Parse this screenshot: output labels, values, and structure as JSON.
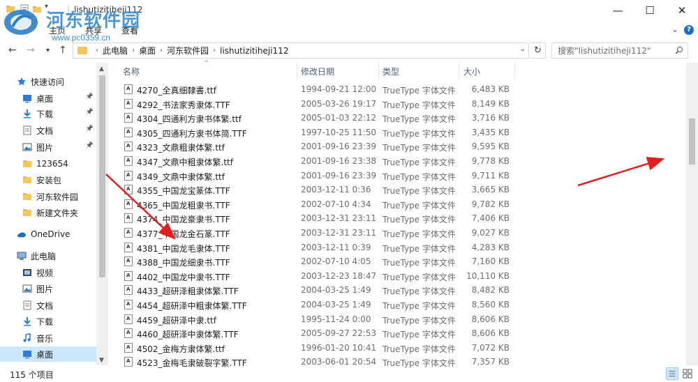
{
  "window": {
    "title": "lishutizitiheji112",
    "minimize_glyph": "—",
    "maximize_glyph": "☐",
    "close_glyph": "✕"
  },
  "watermark": {
    "title": "河东软件园",
    "url": "www.pc0359.cn"
  },
  "ribbon": {
    "tabs": [
      "文件",
      "主页",
      "共享",
      "查看"
    ],
    "expand_glyph": "⌄",
    "help_glyph": "?"
  },
  "address": {
    "breadcrumbs": [
      "此电脑",
      "桌面",
      "河东软件园",
      "lishutizitiheji112"
    ],
    "search_placeholder": "搜索\"lishutizitiheji112\""
  },
  "sidebar": {
    "items": [
      {
        "label": "快速访问",
        "icon": "star-icon",
        "pinned": false,
        "indent": 0
      },
      {
        "label": "桌面",
        "icon": "desktop-icon",
        "pinned": true,
        "indent": 1
      },
      {
        "label": "下载",
        "icon": "download-icon",
        "pinned": true,
        "indent": 1
      },
      {
        "label": "文档",
        "icon": "document-icon",
        "pinned": true,
        "indent": 1
      },
      {
        "label": "图片",
        "icon": "picture-icon",
        "pinned": true,
        "indent": 1
      },
      {
        "label": "123654",
        "icon": "folder-icon",
        "pinned": false,
        "indent": 1
      },
      {
        "label": "安装包",
        "icon": "folder-icon",
        "pinned": false,
        "indent": 1
      },
      {
        "label": "河东软件园",
        "icon": "folder-icon",
        "pinned": false,
        "indent": 1
      },
      {
        "label": "新建文件夹",
        "icon": "folder-icon",
        "pinned": false,
        "indent": 1
      },
      {
        "label": "OneDrive",
        "icon": "cloud-icon",
        "pinned": false,
        "indent": 0
      },
      {
        "label": "此电脑",
        "icon": "computer-icon",
        "pinned": false,
        "indent": 0
      },
      {
        "label": "视频",
        "icon": "video-icon",
        "pinned": false,
        "indent": 1
      },
      {
        "label": "图片",
        "icon": "picture-icon",
        "pinned": false,
        "indent": 1
      },
      {
        "label": "文档",
        "icon": "document-icon",
        "pinned": false,
        "indent": 1
      },
      {
        "label": "下载",
        "icon": "download-icon",
        "pinned": false,
        "indent": 1
      },
      {
        "label": "音乐",
        "icon": "music-icon",
        "pinned": false,
        "indent": 1
      },
      {
        "label": "桌面",
        "icon": "desktop-icon",
        "pinned": false,
        "indent": 1,
        "selected": true
      }
    ]
  },
  "list": {
    "columns": [
      "名称",
      "修改日期",
      "类型",
      "大小"
    ],
    "rows": [
      [
        "4270_全真细隸書.ttf",
        "1994-09-21 12:00",
        "TrueType 字体文件",
        "6,483 KB"
      ],
      [
        "4292_书法家秀隶体.TTF",
        "2005-03-26 19:17",
        "TrueType 字体文件",
        "8,149 KB"
      ],
      [
        "4304_四通利方隶书体繁.ttf",
        "2005-01-03 22:12",
        "TrueType 字体文件",
        "3,716 KB"
      ],
      [
        "4305_四通利方隶书体简.TTF",
        "1997-10-25 11:50",
        "TrueType 字体文件",
        "3,435 KB"
      ],
      [
        "4323_文鼎粗隶体繁.ttf",
        "2001-09-16 23:39",
        "TrueType 字体文件",
        "9,595 KB"
      ],
      [
        "4347_文鼎中粗隶体繁.ttf",
        "2001-09-16 23:38",
        "TrueType 字体文件",
        "9,778 KB"
      ],
      [
        "4349_文鼎中隶体繁.ttf",
        "2001-09-16 23:39",
        "TrueType 字体文件",
        "9,711 KB"
      ],
      [
        "4355_中国龙宝篆体.TTF",
        "2003-12-11 0:36",
        "TrueType 字体文件",
        "3,665 KB"
      ],
      [
        "4365_中国龙粗隶书.TTF",
        "2002-07-10 4:34",
        "TrueType 字体文件",
        "9,782 KB"
      ],
      [
        "4374_中国龙豪隶书.TTF",
        "2003-12-31 23:11",
        "TrueType 字体文件",
        "7,406 KB"
      ],
      [
        "4377_中国龙金石篆.TTF",
        "2003-12-31 23:11",
        "TrueType 字体文件",
        "9,027 KB"
      ],
      [
        "4381_中国龙毛隶体.TTF",
        "2003-12-11 0:39",
        "TrueType 字体文件",
        "4,283 KB"
      ],
      [
        "4388_中国龙细隶书.TTF",
        "2002-07-10 4:05",
        "TrueType 字体文件",
        "7,160 KB"
      ],
      [
        "4402_中国龙中隶书.TTF",
        "2003-12-23 18:47",
        "TrueType 字体文件",
        "10,110 KB"
      ],
      [
        "4433_超研泽粗隶体繁.TTF",
        "2004-03-25 1:49",
        "TrueType 字体文件",
        "8,482 KB"
      ],
      [
        "4454_超研泽中粗隶体繁.TTF",
        "2004-03-25 1:49",
        "TrueType 字体文件",
        "8,560 KB"
      ],
      [
        "4459_超研泽中隶.ttf",
        "1995-11-24 0:00",
        "TrueType 字体文件",
        "8,606 KB"
      ],
      [
        "4460_超研泽中隶体繁.TTF",
        "2005-09-27 22:53",
        "TrueType 字体文件",
        "8,606 KB"
      ],
      [
        "4502_金梅方隶体繁.ttf",
        "1996-01-20 10:41",
        "TrueType 字体文件",
        "7,072 KB"
      ],
      [
        "4523_金梅毛隶破裂字繁.TTF",
        "2003-06-01 20:54",
        "TrueType 字体文件",
        "7,357 KB"
      ]
    ]
  },
  "status": {
    "count": "115 个项目"
  },
  "colors": {
    "accent": "#1e6fc0",
    "folder": "#f2c75c",
    "selection": "#cce8ff",
    "annotation_arrow": "#e02020"
  }
}
